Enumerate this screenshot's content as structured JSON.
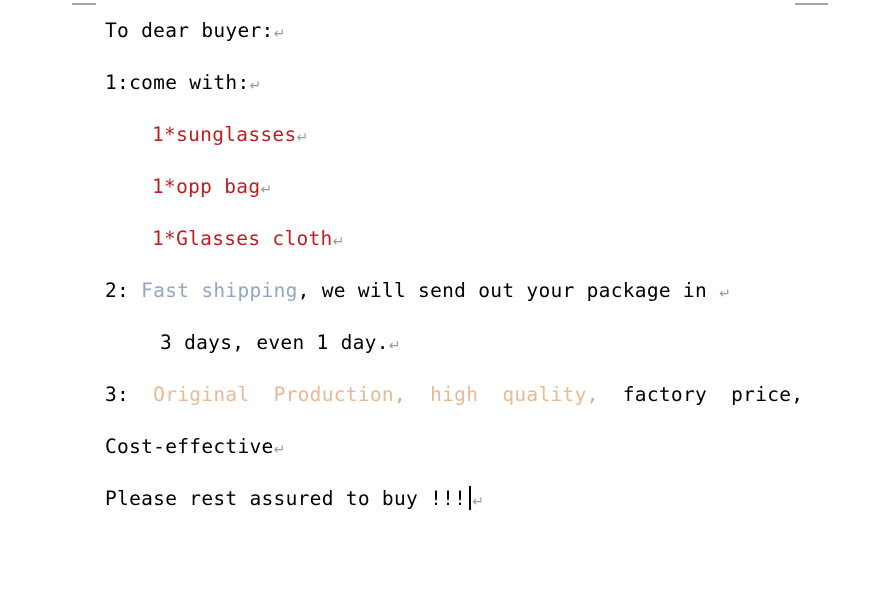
{
  "document": {
    "page_background": "#ffffff",
    "margin_marker_color": "#a6a6a6",
    "caret_color": "#000000",
    "return_mark_glyph": "↵",
    "return_mark_color": "#9a9a9a",
    "colors": {
      "text": "#000000",
      "red": "#bf1e1e",
      "blue": "#8fa7c0",
      "orange": "#eab892",
      "orange_dark": "#e0a878"
    },
    "lines": {
      "greeting": {
        "text": "To dear buyer:"
      },
      "item_header": {
        "text": "1:come with:"
      },
      "item_1": {
        "text": "1*sunglasses"
      },
      "item_2": {
        "text": "1*opp bag"
      },
      "item_3": {
        "text": "1*Glasses cloth"
      },
      "shipping": {
        "prefix": "2: ",
        "highlight": "Fast shipping",
        "rest": ", we will send out your package in "
      },
      "shipping_cont": {
        "text": "3 days, even 1 day."
      },
      "quality": {
        "prefix": "3: ",
        "highlight_1": " Original  Production",
        "comma_1": ",",
        "highlight_2": "  high  quality",
        "comma_2": ",",
        "rest": "  factory  price,"
      },
      "cost": {
        "text": "Cost-effective"
      },
      "closing": {
        "text": "Please rest assured to buy !!!"
      }
    }
  }
}
